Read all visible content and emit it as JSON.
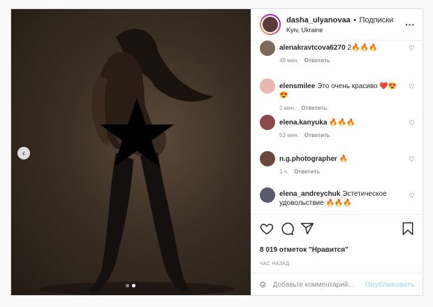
{
  "post": {
    "username": "dasha_ulyanovaa",
    "separator": "•",
    "follow_label": "Подписки",
    "location": "Kyiv, Ukraine",
    "more_icon": "more-horizontal-icon"
  },
  "comments": [
    {
      "user": "alenakravtcova6270",
      "text": "2🔥🔥🔥",
      "time": "49 мин.",
      "reply": "Ответить",
      "avatar_color": "#7a6a5a"
    },
    {
      "user": "elensmilee",
      "text": "Это очень красиво ❤️😍😍",
      "time": "2 мин.",
      "reply": "Ответить",
      "avatar_color": "#e6b8b0"
    },
    {
      "user": "elena.kanyuka",
      "text": "🔥🔥🔥",
      "time": "53 мин.",
      "reply": "Ответить",
      "avatar_color": "#8a4a4a"
    },
    {
      "user": "n.g.photographer",
      "text": "🔥",
      "time": "1 ч.",
      "reply": "Ответить",
      "avatar_color": "#6a4a3a"
    },
    {
      "user": "elena_andreychuk",
      "text": "Эстетическое удовольствие 🔥🔥🔥",
      "time": "",
      "reply": "",
      "avatar_color": "#5a5a6a"
    }
  ],
  "actions": {
    "likes": "8 019 отметок \"Нравится\"",
    "time": "ЧАС НАЗАД"
  },
  "add_comment": {
    "placeholder": "Добавьте комментарий...",
    "publish": "Опубликовать"
  },
  "carousel": {
    "count": 2,
    "active_index": 1
  }
}
